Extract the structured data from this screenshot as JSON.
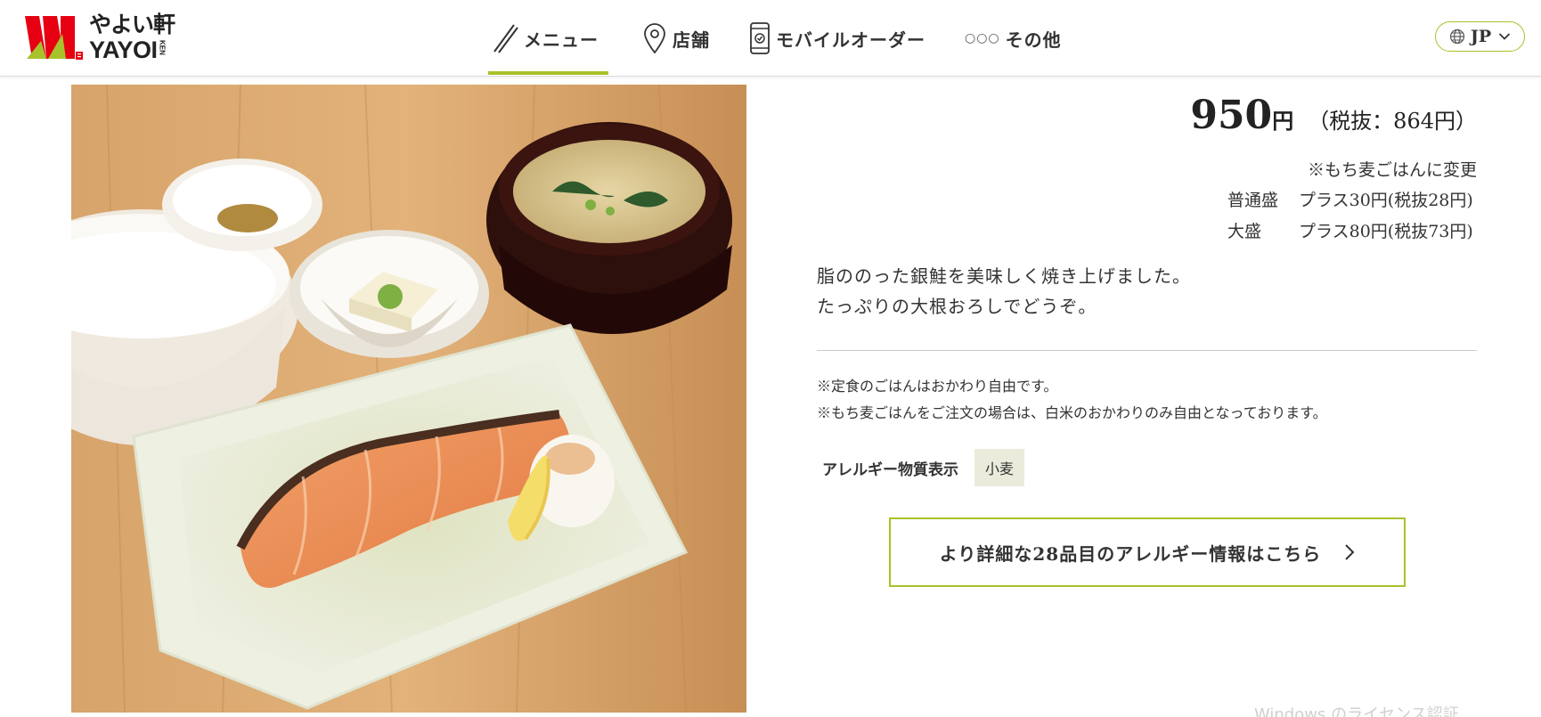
{
  "header": {
    "logo": {
      "text_jp": "やよい軒",
      "text_en": "YAYOI",
      "text_small": "KEN"
    },
    "nav": [
      {
        "label": "メニュー",
        "icon": "chopsticks-icon",
        "active": true
      },
      {
        "label": "店舗",
        "icon": "map-pin-icon",
        "active": false
      },
      {
        "label": "モバイルオーダー",
        "icon": "smartphone-icon",
        "active": false
      },
      {
        "label": "その他",
        "icon": "dots-icon",
        "active": false
      }
    ],
    "language": {
      "label": "JP",
      "icon": "globe-icon"
    }
  },
  "product": {
    "price": "950",
    "price_unit": "円",
    "price_tax_excluded": "（税抜：864円）",
    "option_note": "※もち麦ごはんに変更",
    "options": [
      {
        "size": "普通盛",
        "price": "プラス30円(税抜28円)"
      },
      {
        "size": "大盛",
        "price": "プラス80円(税抜73円)"
      }
    ],
    "description": [
      "脂ののった銀鮭を美味しく焼き上げました。",
      "たっぷりの大根おろしでどうぞ。"
    ],
    "notes": [
      "※定食のごはんはおかわり自由です。",
      "※もち麦ごはんをご注文の場合は、白米のおかわりのみ自由となっております。"
    ],
    "allergy_label": "アレルギー物質表示",
    "allergens": [
      "小麦"
    ],
    "allergy_button_label": "より詳細な28品目のアレルギー情報はこちら"
  },
  "system": {
    "watermark": "Windows のライセンス認証"
  },
  "colors": {
    "accent": "#a7c22a",
    "logo_red": "#e60012",
    "logo_green": "#a7c22a",
    "tag_bg": "#ebebdc"
  }
}
